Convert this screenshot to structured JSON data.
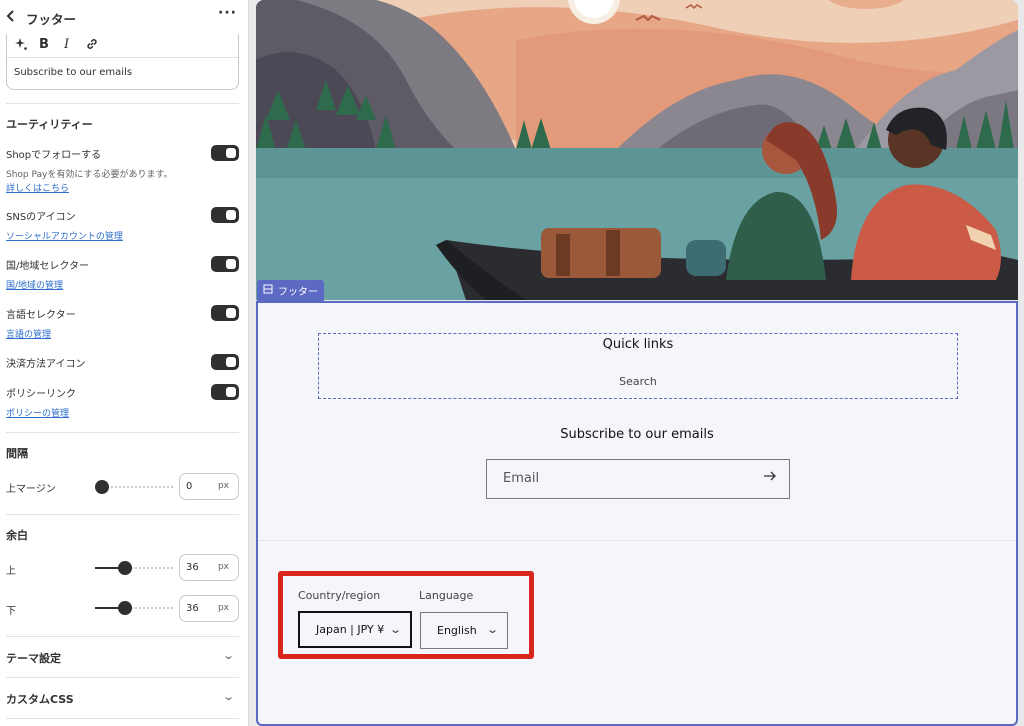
{
  "sidebar": {
    "title": "フッター",
    "more": "···",
    "newsletter_heading": "Subscribe to our emails",
    "utility": {
      "heading": "ユーティリティー",
      "follow_shop": {
        "label": "Shopでフォローする",
        "help": "Shop Payを有効にする必要があります。",
        "link": "詳しくはこちら",
        "enabled": true
      },
      "social_icons": {
        "label": "SNSのアイコン",
        "link": "ソーシャルアカウントの管理",
        "enabled": true
      },
      "country_selector": {
        "label": "国/地域セレクター",
        "link": "国/地域の管理",
        "enabled": true
      },
      "language_selector": {
        "label": "言語セレクター",
        "link": "言語の管理",
        "enabled": true
      },
      "payment_icons": {
        "label": "決済方法アイコン",
        "enabled": true
      },
      "policy_links": {
        "label": "ポリシーリンク",
        "link": "ポリシーの管理",
        "enabled": true
      }
    },
    "spacing": {
      "heading": "間隔",
      "top_margin": {
        "label": "上マージン",
        "value": "0",
        "unit": "px"
      }
    },
    "padding": {
      "heading": "余白",
      "top": {
        "label": "上",
        "value": "36",
        "unit": "px"
      },
      "bottom": {
        "label": "下",
        "value": "36",
        "unit": "px"
      }
    },
    "theme_settings": "テーマ設定",
    "custom_css": "カスタムCSS"
  },
  "preview": {
    "section_tag": "フッター",
    "quick_links": {
      "title": "Quick links",
      "items": [
        "Search"
      ]
    },
    "newsletter": {
      "title": "Subscribe to our emails",
      "placeholder": "Email"
    },
    "localization": {
      "country_label": "Country/region",
      "country_value": "Japan | JPY ¥",
      "language_label": "Language",
      "language_value": "English"
    }
  },
  "colors": {
    "accent": "#5c6ac4",
    "highlight": "#d8261c",
    "link": "#2c6ecb"
  }
}
